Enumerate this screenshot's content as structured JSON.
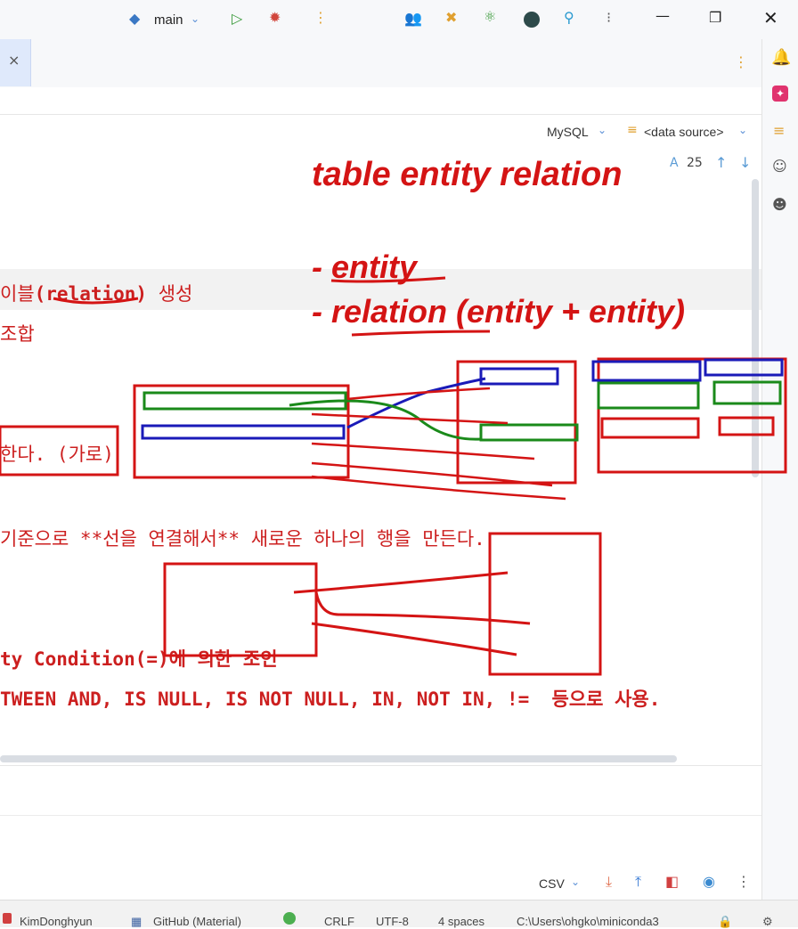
{
  "titlebar": {
    "branch": "main",
    "icons": [
      "python-icon",
      "branch-chevron-icon",
      "run-icon",
      "debug-icon",
      "more-icon",
      "people-icon",
      "build-icon",
      "atom-icon",
      "record-icon",
      "search-icon",
      "notify-dots-icon",
      "minimize-icon",
      "maximize-icon",
      "close-icon"
    ]
  },
  "tab": {
    "close_glyph": "×"
  },
  "toolbar2": {
    "dialect": "MySQL",
    "data_source": "<data source>"
  },
  "editor": {
    "hint_count": "25",
    "lines": {
      "l1_prefix": "이블",
      "l1_relation": "(relation)",
      "l1_suffix": " 생성",
      "l2": "조합",
      "l3": "한다. (가로)",
      "l4": "기준으로 **선을 연결해서** 새로운 하나의 행을 만든다.",
      "l5": "ty Condition(=)에 의한 조인",
      "l6": "TWEEN AND, IS NULL, IS NOT NULL, IN, NOT IN, !=  등으로 사용."
    }
  },
  "handwriting": {
    "title": "table  entity relation",
    "item1": "- entity",
    "item2": "- relation (entity + entity)"
  },
  "bottom": {
    "format": "CSV"
  },
  "status": {
    "user": "KimDonghyun",
    "theme": "GitHub (Material)",
    "line_sep": "CRLF",
    "encoding": "UTF-8",
    "indent": "4 spaces",
    "path": "C:\\Users\\ohgko\\miniconda3"
  }
}
